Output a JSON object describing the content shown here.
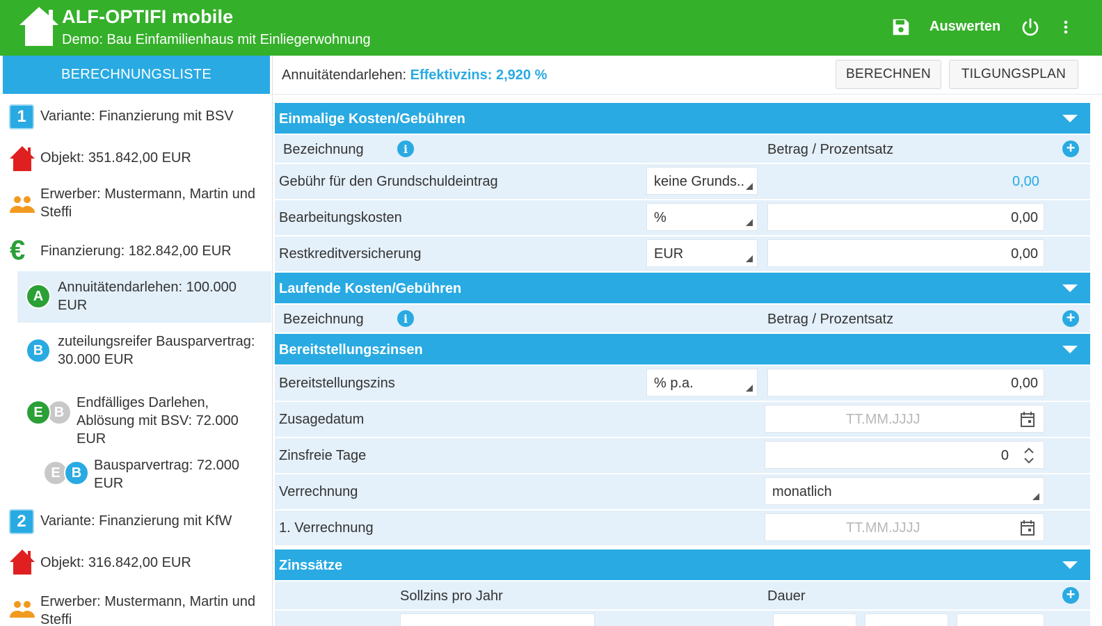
{
  "app": {
    "title": "ALF-OPTIFI mobile",
    "subtitle": "Demo: Bau Einfamilienhaus mit Einliegerwohnung",
    "action_auswerten": "Auswerten",
    "brand_color": "#35b02a",
    "accent_color": "#29aae2"
  },
  "sidebar": {
    "tab": "BERECHNUNGSLISTE",
    "items": [
      {
        "icon": "variant-1-icon",
        "badge": "1",
        "label": "Variante: Finanzierung mit BSV"
      },
      {
        "icon": "house-icon",
        "label": "Objekt: 351.842,00 EUR"
      },
      {
        "icon": "people-icon",
        "label": "Erwerber: Mustermann, Martin und Steffi"
      },
      {
        "icon": "euro-icon",
        "label": "Finanzierung: 182.842,00 EUR"
      },
      {
        "icon": "loan-a-icon",
        "badge": "A",
        "label": "Annuitätendarlehen: 100.000 EUR"
      },
      {
        "icon": "loan-b-icon",
        "badge": "B",
        "label": "zuteilungsreifer Bausparvertrag: 30.000 EUR"
      },
      {
        "icon": "loan-eb-icon",
        "badge": "E",
        "badge2": "B",
        "label": "Endfälliges Darlehen, Ablösung mit BSV: 72.000 EUR"
      },
      {
        "icon": "loan-eb2-icon",
        "badge": "E",
        "badge2": "B",
        "label": "Bausparvertrag: 72.000 EUR"
      },
      {
        "icon": "variant-2-icon",
        "badge": "2",
        "label": "Variante: Finanzierung mit KfW"
      },
      {
        "icon": "house-icon",
        "label": "Objekt: 316.842,00 EUR"
      },
      {
        "icon": "people-icon",
        "label": "Erwerber: Mustermann, Martin und Steffi"
      }
    ]
  },
  "topbar": {
    "loan_label": "Annuitätendarlehen:",
    "effective": "Effektivzins: 2,920 %",
    "btn_calc": "BERECHNEN",
    "btn_plan": "TILGUNGSPLAN"
  },
  "sections": {
    "einmalig": "Einmalige Kosten/Gebühren",
    "laufend": "Laufende Kosten/Gebühren",
    "bereit": "Bereitstellungszinsen",
    "zins": "Zinssätze"
  },
  "headers": {
    "bezeichnung": "Bezeichnung",
    "betrag": "Betrag / Prozentsatz",
    "sollzins": "Sollzins pro Jahr",
    "dauer": "Dauer"
  },
  "einmalig_rows": [
    {
      "label": "Gebühr für den Grundschuldeintrag",
      "select": "keine Grunds..",
      "value": "0,00"
    },
    {
      "label": "Bearbeitungskosten",
      "select": "%",
      "value": "0,00"
    },
    {
      "label": "Restkreditversicherung",
      "select": "EUR",
      "value": "0,00"
    }
  ],
  "bereit_rows": {
    "zins_label": "Bereitstellungszins",
    "zins_select": "% p.a.",
    "zins_value": "0,00",
    "zusage_label": "Zusagedatum",
    "date_placeholder": "TT.MM.JJJJ",
    "tage_label": "Zinsfreie Tage",
    "tage_value": "0",
    "verrechnung_label": "Verrechnung",
    "verrechnung_value": "monatlich",
    "erste_label": "1. Verrechnung"
  }
}
